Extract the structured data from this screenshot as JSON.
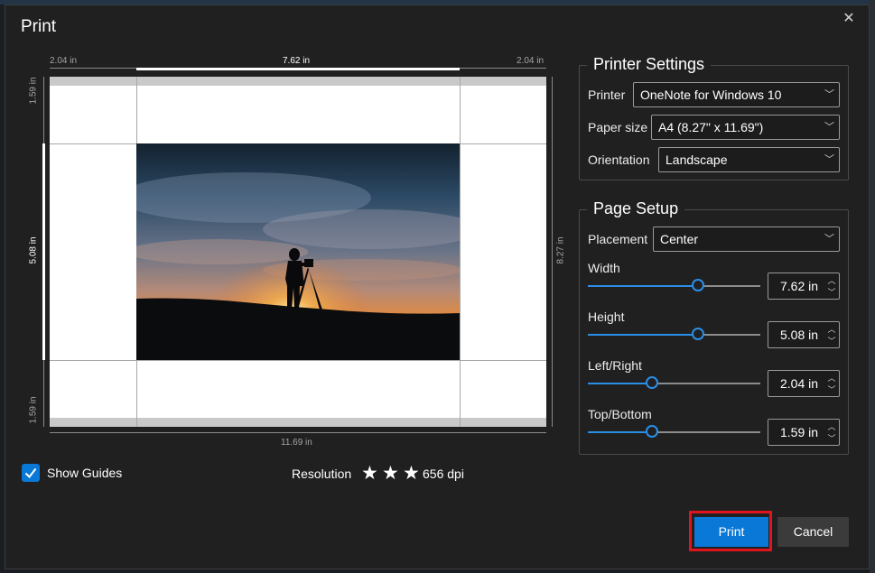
{
  "dialog": {
    "title": "Print",
    "close_icon": "close-icon"
  },
  "preview": {
    "top_left_margin": "2.04 in",
    "top_width": "7.62 in",
    "top_right_margin": "2.04 in",
    "left_top_margin": "1.59 in",
    "left_height": "5.08 in",
    "left_bottom_margin": "1.59 in",
    "right_paper_height": "8.27 in",
    "bottom_paper_width": "11.69 in"
  },
  "options": {
    "show_guides_label": "Show Guides",
    "show_guides_checked": true,
    "resolution_label": "Resolution",
    "resolution_stars": 3,
    "dpi": "656 dpi"
  },
  "printer_settings": {
    "legend": "Printer Settings",
    "printer_label": "Printer",
    "printer_value": "OneNote for Windows 10",
    "paper_label": "Paper size",
    "paper_value": "A4 (8.27\" x 11.69\")",
    "orientation_label": "Orientation",
    "orientation_value": "Landscape"
  },
  "page_setup": {
    "legend": "Page Setup",
    "placement_label": "Placement",
    "placement_value": "Center",
    "width_label": "Width",
    "width_value": "7.62 in",
    "width_slider": 0.64,
    "height_label": "Height",
    "height_value": "5.08 in",
    "height_slider": 0.64,
    "leftright_label": "Left/Right",
    "leftright_value": "2.04 in",
    "leftright_slider": 0.37,
    "topbottom_label": "Top/Bottom",
    "topbottom_value": "1.59 in",
    "topbottom_slider": 0.37
  },
  "buttons": {
    "print": "Print",
    "cancel": "Cancel"
  },
  "colors": {
    "accent": "#0a78d7",
    "highlight_outline": "#e0141e",
    "dialog_bg": "#202020"
  }
}
